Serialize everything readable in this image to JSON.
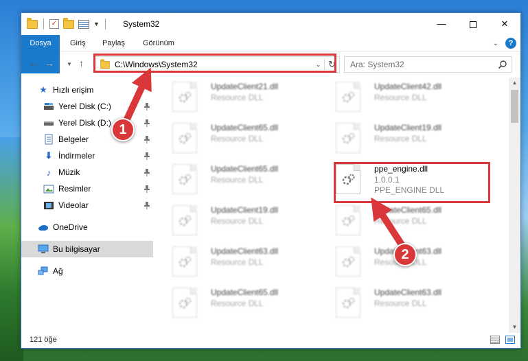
{
  "window": {
    "title": "System32",
    "min_glyph": "—",
    "close_glyph": "✕"
  },
  "ribbon": {
    "tabs": [
      "Dosya",
      "Giriş",
      "Paylaş",
      "Görünüm"
    ],
    "help_glyph": "?"
  },
  "navbar": {
    "address": "C:\\Windows\\System32",
    "search_placeholder": "Ara: System32"
  },
  "sidebar": {
    "items": [
      {
        "label": "Hızlı erişim",
        "icon": "star-icon",
        "pinned": false
      },
      {
        "label": "Yerel Disk (C:)",
        "icon": "drive-icon",
        "pinned": true
      },
      {
        "label": "Yerel Disk (D:)",
        "icon": "drive-icon",
        "pinned": true
      },
      {
        "label": "Belgeler",
        "icon": "documents-icon",
        "pinned": true
      },
      {
        "label": "İndirmeler",
        "icon": "download-icon",
        "pinned": true
      },
      {
        "label": "Müzik",
        "icon": "music-icon",
        "pinned": true
      },
      {
        "label": "Resimler",
        "icon": "pictures-icon",
        "pinned": true
      },
      {
        "label": "Videolar",
        "icon": "videos-icon",
        "pinned": true
      },
      {
        "label": "OneDrive",
        "icon": "cloud-icon",
        "pinned": false
      },
      {
        "label": "Bu bilgisayar",
        "icon": "computer-icon",
        "pinned": false,
        "selected": true
      },
      {
        "label": "Ağ",
        "icon": "network-icon",
        "pinned": false
      }
    ]
  },
  "files": {
    "left": [
      {
        "name": "UpdateClient21.dll",
        "desc": "Resource DLL"
      },
      {
        "name": "UpdateClient65.dll",
        "desc": "Resource DLL"
      },
      {
        "name": "UpdateClient65.dll",
        "desc": "Resource DLL"
      },
      {
        "name": "UpdateClient19.dll",
        "desc": "Resource DLL"
      },
      {
        "name": "UpdateClient63.dll",
        "desc": "Resource DLL"
      },
      {
        "name": "UpdateClient65.dll",
        "desc": "Resource DLL"
      }
    ],
    "right": [
      {
        "name": "UpdateClient42.dll",
        "desc": "Resource DLL"
      },
      {
        "name": "UpdateClient19.dll",
        "desc": "Resource DLL"
      },
      {
        "name": "UpdateClient65.dll",
        "desc": "Resource DLL"
      },
      {
        "name": "UpdateClient63.dll",
        "desc": "Resource DLL"
      },
      {
        "name": "UpdateClient63.dll",
        "desc": "Resource DLL"
      }
    ],
    "highlighted": {
      "name": "ppe_engine.dll",
      "version": "1.0.0.1",
      "desc": "PPE_ENGINE DLL"
    }
  },
  "status": {
    "count": "121 öğe"
  },
  "callouts": {
    "one": "1",
    "two": "2"
  },
  "colors": {
    "accent": "#1979ca",
    "highlight": "#d9373a"
  }
}
